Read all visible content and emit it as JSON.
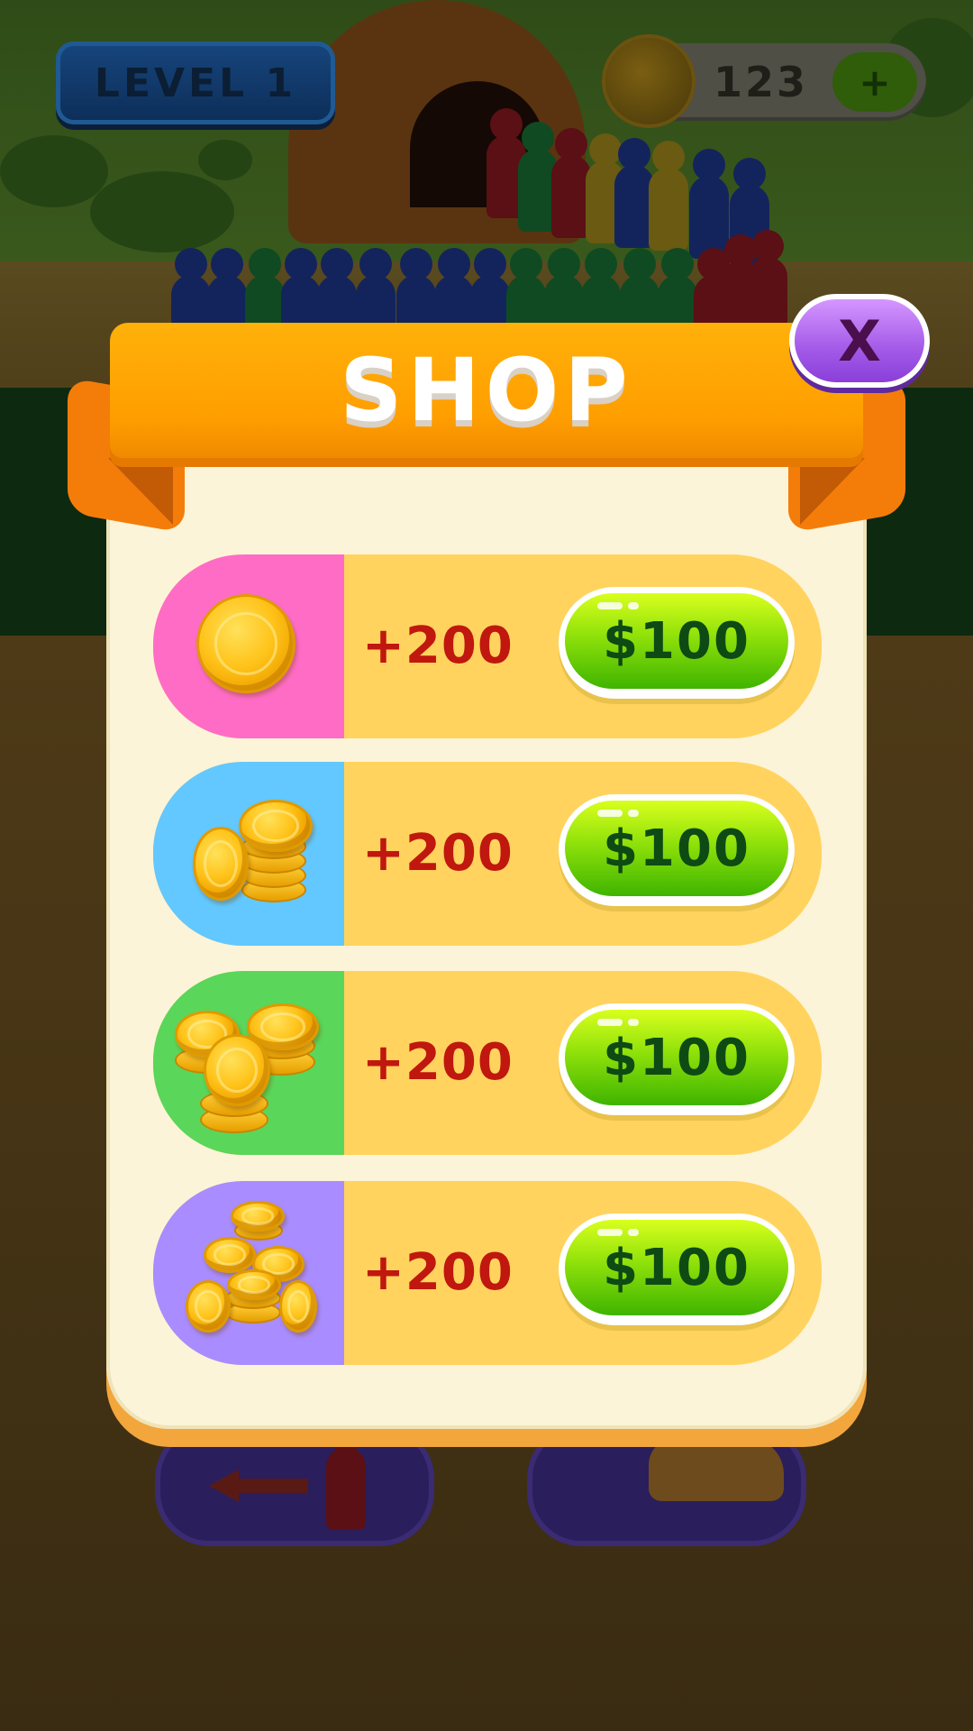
{
  "hud": {
    "level_label": "LEVEL 1",
    "coin_balance": "123",
    "add_coins_label": "+"
  },
  "shop": {
    "title": "SHOP",
    "close_label": "X",
    "items": [
      {
        "amount": "+200",
        "price": "$100",
        "icon": "single-coin-icon",
        "tile_color": "#ff6cc6"
      },
      {
        "amount": "+200",
        "price": "$100",
        "icon": "coin-stack-icon",
        "tile_color": "#62c8ff"
      },
      {
        "amount": "+200",
        "price": "$100",
        "icon": "coin-stacks-icon",
        "tile_color": "#5ad65a"
      },
      {
        "amount": "+200",
        "price": "$100",
        "icon": "coin-pile-icon",
        "tile_color": "#a98cff"
      }
    ]
  },
  "colors": {
    "ribbon": "#ffa800",
    "row_background": "#ffd35e",
    "price_button": "#5cc800",
    "amount_text": "#c0170e",
    "close_button": "#b46cf0"
  }
}
